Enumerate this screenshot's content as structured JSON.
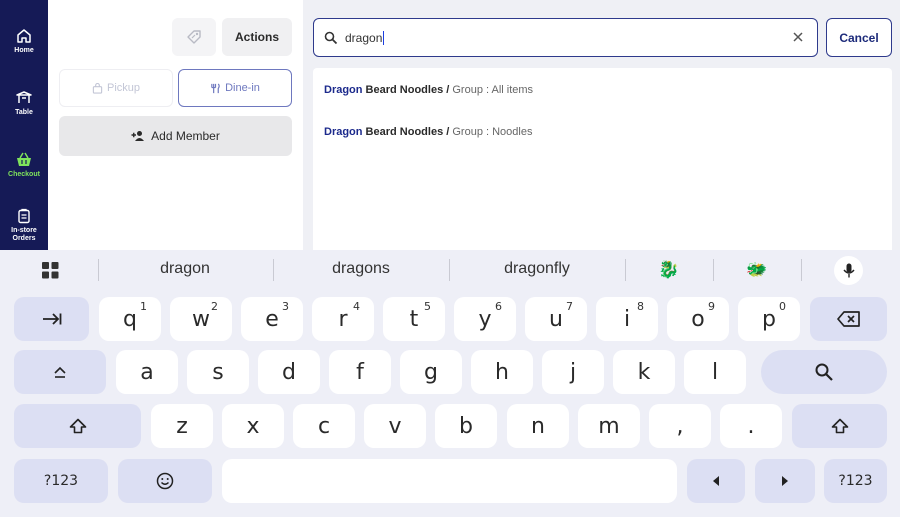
{
  "sidebar": {
    "items": [
      {
        "label": "Home",
        "icon": "home-icon"
      },
      {
        "label": "Table",
        "icon": "table-icon"
      },
      {
        "label": "Checkout",
        "icon": "basket-icon"
      },
      {
        "label": "In-store Orders",
        "icon": "clipboard-icon"
      }
    ],
    "active": "Checkout"
  },
  "left_panel": {
    "actions_label": "Actions",
    "pickup_label": "Pickup",
    "dinein_label": "Dine-in",
    "add_member_label": "Add Member"
  },
  "search": {
    "value": "dragon",
    "cancel_label": "Cancel"
  },
  "results": [
    {
      "match": "Dragon",
      "rest": " Beard Noodles",
      "sep": " / ",
      "group": "Group : All items"
    },
    {
      "match": "Dragon",
      "rest": " Beard Noodles",
      "sep": " / ",
      "group": "Group : Noodles"
    }
  ],
  "keyboard": {
    "suggestions": [
      "dragon",
      "dragons",
      "dragonfly"
    ],
    "emoji_suggestions": [
      "🐉",
      "🐲"
    ],
    "row1": [
      {
        "k": "q",
        "n": "1"
      },
      {
        "k": "w",
        "n": "2"
      },
      {
        "k": "e",
        "n": "3"
      },
      {
        "k": "r",
        "n": "4"
      },
      {
        "k": "t",
        "n": "5"
      },
      {
        "k": "y",
        "n": "6"
      },
      {
        "k": "u",
        "n": "7"
      },
      {
        "k": "i",
        "n": "8"
      },
      {
        "k": "o",
        "n": "9"
      },
      {
        "k": "p",
        "n": "0"
      }
    ],
    "row2": [
      "a",
      "s",
      "d",
      "f",
      "g",
      "h",
      "j",
      "k",
      "l"
    ],
    "row3": [
      "z",
      "x",
      "c",
      "v",
      "b",
      "n",
      "m",
      ",",
      "."
    ],
    "symbols_label": "?123"
  },
  "colors": {
    "sidebar_bg": "#151a56",
    "active_nav": "#7fe35c",
    "accent": "#2e3a8c",
    "keyboard_bg": "#eeeff7"
  }
}
